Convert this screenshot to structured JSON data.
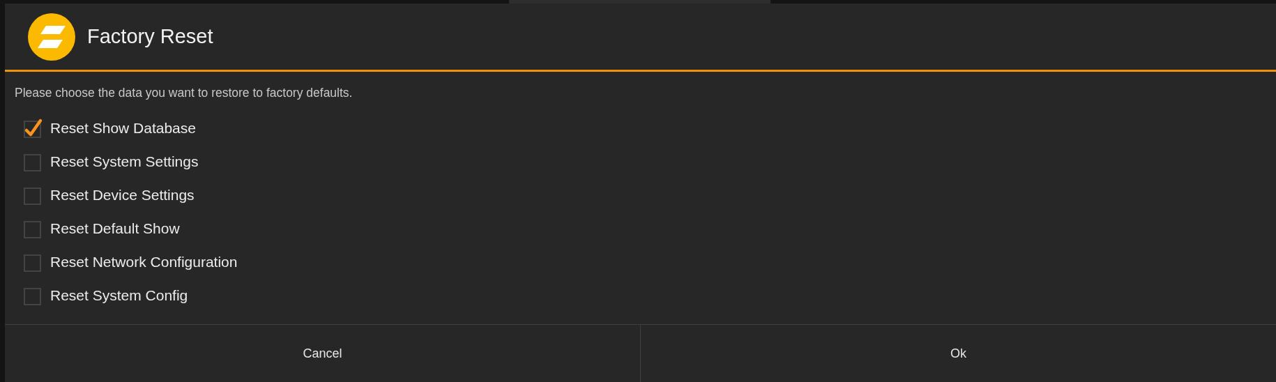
{
  "dialog": {
    "title": "Factory Reset",
    "message": "Please choose the data you want to restore to factory defaults.",
    "options": [
      {
        "label": "Reset Show Database",
        "checked": true
      },
      {
        "label": "Reset System Settings",
        "checked": false
      },
      {
        "label": "Reset Device Settings",
        "checked": false
      },
      {
        "label": "Reset Default Show",
        "checked": false
      },
      {
        "label": "Reset Network Configuration",
        "checked": false
      },
      {
        "label": "Reset System Config",
        "checked": false
      }
    ],
    "buttons": [
      "Cancel",
      "Ok"
    ]
  }
}
